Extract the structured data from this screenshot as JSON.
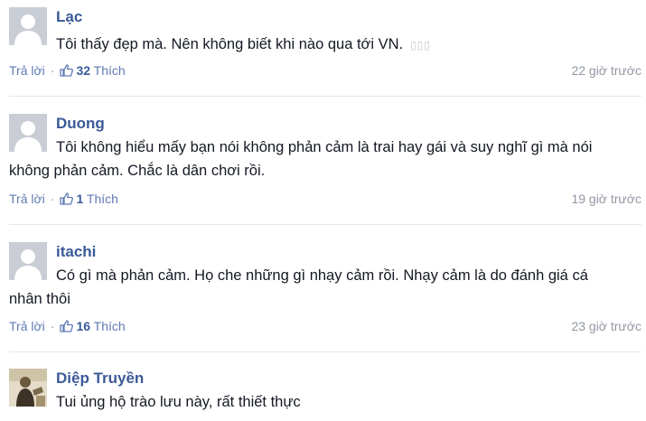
{
  "comments": [
    {
      "author": "Lạc",
      "avatar": "default-avatar-icon",
      "body_lines": [
        "Tôi thấy đẹp mà. Nên không biết khi nào qua tới VN."
      ],
      "trailing_glyphs": "▯▯▯",
      "reply_label": "Trả lời",
      "like_count": "32",
      "like_label": "Thích",
      "time": "22 giờ trước"
    },
    {
      "author": "Duong",
      "avatar": "default-avatar-icon",
      "body_lines": [
        "Tôi không hiểu mấy bạn nói không phản cảm là trai hay gái và suy nghĩ gì mà nói",
        "không phản cảm. Chắc là dân chơi rồi."
      ],
      "reply_label": "Trả lời",
      "like_count": "1",
      "like_label": "Thích",
      "time": "19 giờ trước"
    },
    {
      "author": "itachi",
      "avatar": "default-avatar-icon",
      "body_lines": [
        "Có gì mà phản cảm. Họ che những gì nhạy cảm rồi. Nhạy cảm là do đánh giá cá",
        "nhân thôi"
      ],
      "reply_label": "Trả lời",
      "like_count": "16",
      "like_label": "Thích",
      "time": "23 giờ trước"
    },
    {
      "author": "Diệp Truyền",
      "avatar": "photo-avatar-icon",
      "body_lines": [
        "Tui ủng hộ trào lưu này, rất thiết thực"
      ]
    }
  ],
  "separator": "·",
  "colors": {
    "author": "#3b5998",
    "body": "#141823",
    "meta": "#9197a3",
    "link": "#5f7bb4",
    "avatar_bg": "#c9cdd6",
    "divider": "#e5e7eb"
  }
}
